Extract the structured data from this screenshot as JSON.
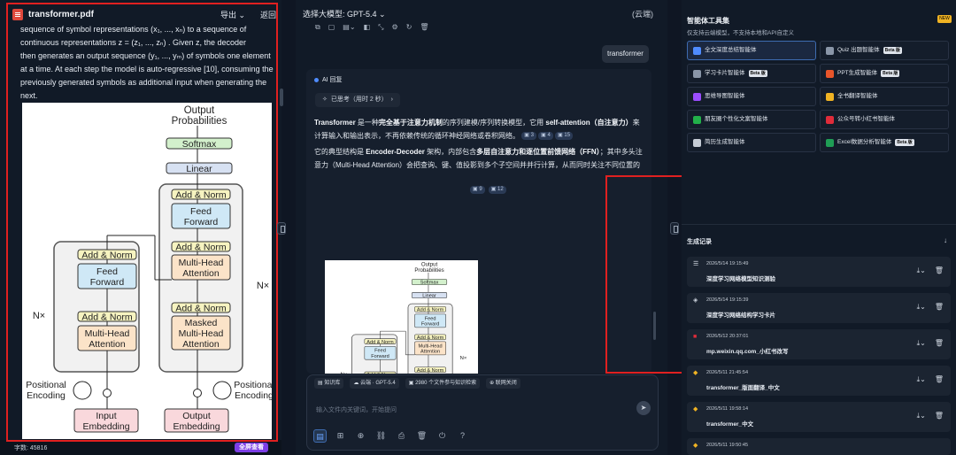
{
  "pdf": {
    "filename": "transformer.pdf",
    "export_label": "导出 ⌄",
    "back_label": "返回",
    "para": [
      "sequence of symbol representations (x₁, ..., xₙ) to a sequence of",
      "continuous representations  z = (z₁, ..., zₙ) . Given z, the decoder",
      "then generates an output sequence (y₁, ..., yₘ) of symbols one element",
      "at a time. At each step the model is auto-regressive [10], consuming the",
      "previously generated symbols as additional input when generating the",
      "next."
    ],
    "char_count": "字数: 45816",
    "fullscreen_label": "全屏查看"
  },
  "diagram": {
    "output_probs": [
      "Output",
      "Probabilities"
    ],
    "softmax": "Softmax",
    "linear": "Linear",
    "add_norm": "Add & Norm",
    "feed_forward": [
      "Feed",
      "Forward"
    ],
    "multi_head": [
      "Multi-Head",
      "Attention"
    ],
    "masked_multi_head": [
      "Masked",
      "Multi-Head",
      "Attention"
    ],
    "nx": "N×",
    "positional_encoding": [
      "Positional",
      "Encoding"
    ],
    "input_embedding": [
      "Input",
      "Embedding"
    ],
    "output_embedding": [
      "Output",
      "Embedding"
    ]
  },
  "chat": {
    "model_selector": "选择大模型: GPT-5.4 ⌄",
    "cloud_label": "(云端)",
    "toolbar_icons": [
      "⧉",
      "▢",
      "▤⌄",
      "◧",
      "⤡",
      "⚙",
      "↻",
      "🗑"
    ],
    "user_message": "transformer",
    "ai_header": "AI 回复",
    "thought_label": "已思考（用时 2 秒）",
    "p1": {
      "t1": "Transformer",
      "t2": " 是一种",
      "t3": "完全基于注意力机制",
      "t4": "的序列建模/序列转换模型，它用 ",
      "t5": "self-attention（自注意力）",
      "t6": "来计算输入和输出表示，不再依赖传统的循环神经网络或卷积网络。"
    },
    "p1_refs": [
      "3",
      "4",
      "15"
    ],
    "p2": {
      "t1": "它的典型结构是 ",
      "t2": "Encoder-Decoder",
      "t3": " 架构，内部包含",
      "t4": "多层自注意力和逐位置前馈网络（FFN）",
      "t5": "；其中多头注意力（Multi-Head Attention）会把查询、键、值投影到多个子空间并并行计算，从而同时关注不同位置的信息。"
    },
    "p2_refs": [
      "9",
      "12"
    ],
    "chips": [
      "知识库",
      "云端 · GPT-5.4",
      "2980 个文件参与知识检索",
      "联网关闭"
    ],
    "placeholder": "输入文件内关键词，开始提问",
    "send_icon": "➤",
    "bottom_icons": [
      "▤",
      "⊞",
      "⊕",
      "⛓",
      "⎙",
      "🗑",
      "⏻",
      "?"
    ]
  },
  "tools": {
    "title": "智能体工具集",
    "subtitle": "仅支持云端模型，不支持本地和API自定义",
    "new_badge": "NEW",
    "items": [
      {
        "label": "全文深度总结智能体",
        "badge": "",
        "color": "#4f8cff"
      },
      {
        "label": "Quiz 出题智能体",
        "badge": "Beta 版",
        "color": "#8a96a8"
      },
      {
        "label": "学习卡片智能体",
        "badge": "Beta 版",
        "color": "#8a96a8"
      },
      {
        "label": "PPT生成智能体",
        "badge": "Beta 版",
        "color": "#e8552a"
      },
      {
        "label": "思维导图智能体",
        "badge": "",
        "color": "#9b4dff"
      },
      {
        "label": "全书翻译智能体",
        "badge": "",
        "color": "#f0b323"
      },
      {
        "label": "朋友圈个性化文案智能体",
        "badge": "",
        "color": "#22b04a"
      },
      {
        "label": "公众号转小红书智能体",
        "badge": "",
        "color": "#e02c3a"
      },
      {
        "label": "简历生成智能体",
        "badge": "",
        "color": "#c5ccd6"
      },
      {
        "label": "Excel数据分析智能体",
        "badge": "Beta 版",
        "color": "#1f9d55"
      }
    ],
    "history_title": "生成记录",
    "history_download": "↓",
    "history": [
      {
        "date": "2026/5/14 19:15:49",
        "name": "深度学习网络模型知识测验",
        "icon": "☰"
      },
      {
        "date": "2026/5/14 19:15:39",
        "name": "深度学习网络结构学习卡片",
        "icon": "◈"
      },
      {
        "date": "2026/5/12 20:37:01",
        "name": "mp.weixin.qq.com_小红书改写",
        "icon": "■"
      },
      {
        "date": "2026/5/11 21:45:54",
        "name": "transformer_版面翻译_中文",
        "icon": "◆"
      },
      {
        "date": "2026/5/11 19:58:14",
        "name": "transformer_中文",
        "icon": "◆"
      },
      {
        "date": "2026/5/11 19:50:45",
        "name": "",
        "icon": "◆"
      }
    ],
    "history_actions": [
      "⤓⌄",
      "🗑"
    ]
  }
}
